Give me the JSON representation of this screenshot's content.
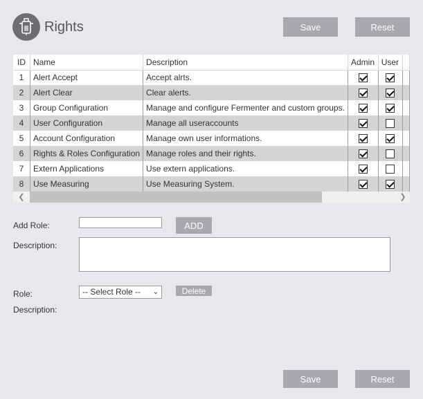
{
  "header": {
    "title": "Rights",
    "icon": "fermenter-icon"
  },
  "toolbar": {
    "save_label": "Save",
    "reset_label": "Reset"
  },
  "table": {
    "columns": [
      "ID",
      "Name",
      "Description",
      "Admin",
      "User"
    ],
    "rows": [
      {
        "id": "1",
        "name": "Alert Accept",
        "description": "Accept alrts.",
        "admin": true,
        "user": true
      },
      {
        "id": "2",
        "name": "Alert Clear",
        "description": "Clear alerts.",
        "admin": true,
        "user": true
      },
      {
        "id": "3",
        "name": "Group Configuration",
        "description": "Manage and configure Fermenter and custom groups.",
        "admin": true,
        "user": true
      },
      {
        "id": "4",
        "name": "User Configuration",
        "description": "Manage all useraccounts",
        "admin": true,
        "user": false
      },
      {
        "id": "5",
        "name": "Account Configuration",
        "description": "Manage own user informations.",
        "admin": true,
        "user": true
      },
      {
        "id": "6",
        "name": "Rights & Roles Configuration",
        "description": "Manage roles and their rights.",
        "admin": true,
        "user": false
      },
      {
        "id": "7",
        "name": "Extern Applications",
        "description": "Use extern applications.",
        "admin": true,
        "user": false
      },
      {
        "id": "8",
        "name": "Use Measuring",
        "description": "Use Measuring System.",
        "admin": true,
        "user": true
      }
    ]
  },
  "add_role": {
    "label": "Add Role:",
    "value": "",
    "button": "ADD",
    "description_label": "Description:",
    "description_value": ""
  },
  "role": {
    "label": "Role:",
    "selected": "-- Select Role --",
    "delete_button": "Delete",
    "description_label": "Description:"
  },
  "footer": {
    "save_label": "Save",
    "reset_label": "Reset"
  }
}
